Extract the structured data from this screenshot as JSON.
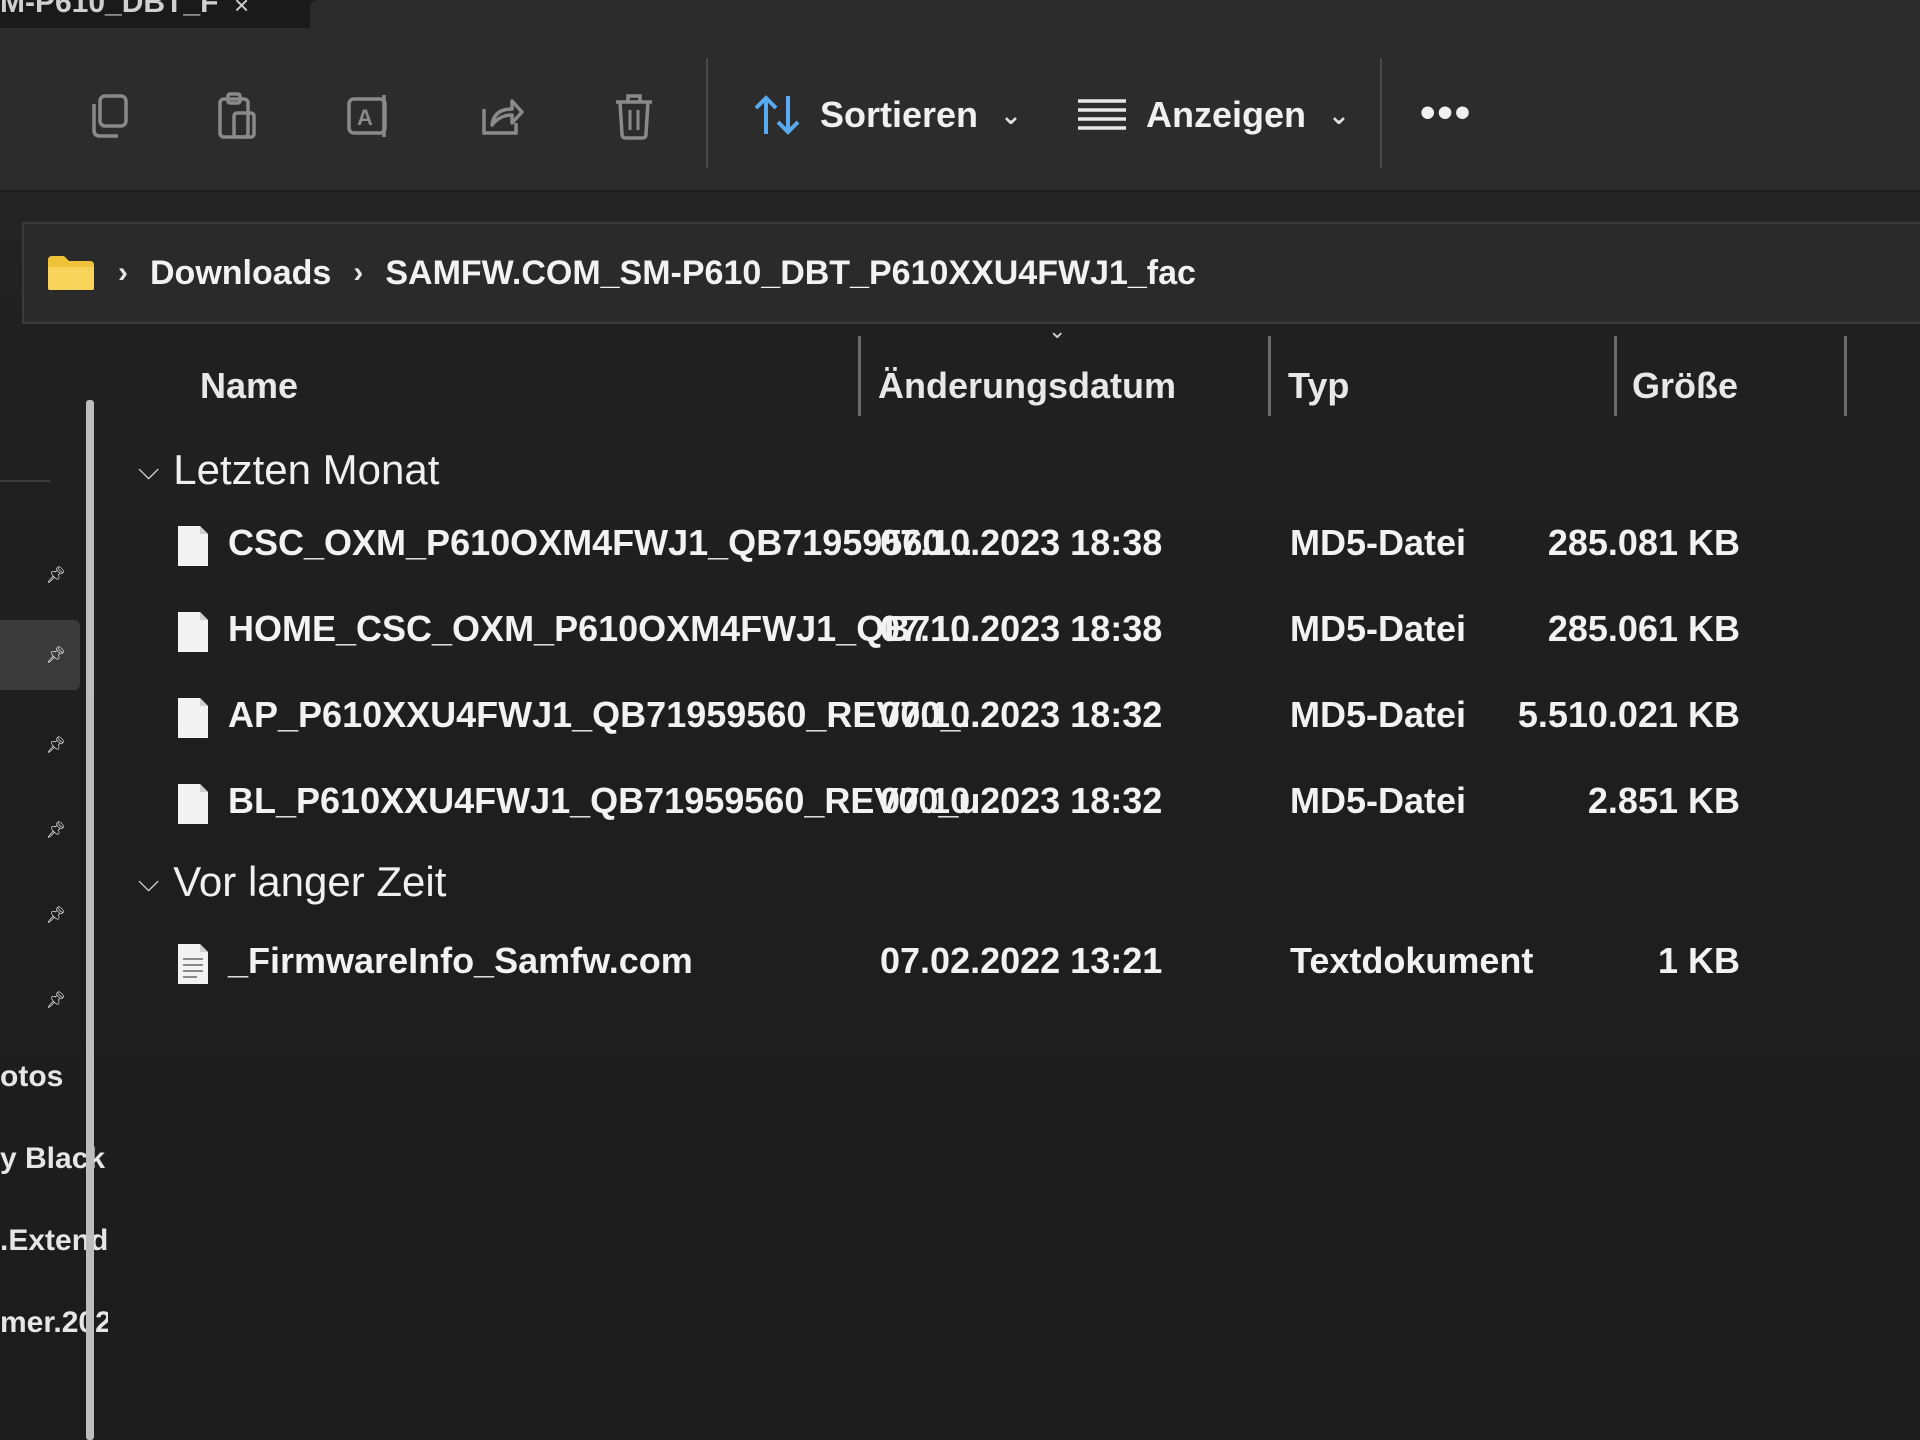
{
  "window": {
    "title_fragment": "M-P610_DBT_F",
    "title_close": "×"
  },
  "toolbar": {
    "icons": [
      {
        "name": "copy-icon"
      },
      {
        "name": "paste-icon"
      },
      {
        "name": "rename-icon"
      },
      {
        "name": "share-icon"
      },
      {
        "name": "delete-icon"
      }
    ],
    "sort_label": "Sortieren",
    "view_label": "Anzeigen",
    "more_label": "•••"
  },
  "address": {
    "separator": "›",
    "crumbs": [
      "Downloads",
      "SAMFW.COM_SM-P610_DBT_P610XXU4FWJ1_fac"
    ]
  },
  "nav": {
    "items": [
      "otos",
      "y Black",
      ".Extend",
      "mer.202"
    ]
  },
  "columns": {
    "name": "Name",
    "date": "Änderungsdatum",
    "type": "Typ",
    "size": "Größe"
  },
  "groups": [
    {
      "label": "Letzten Monat",
      "files": [
        {
          "name": "CSC_OXM_P610OXM4FWJ1_QB71959560...",
          "date": "07.10.2023 18:38",
          "type": "MD5-Datei",
          "size": "285.081 KB"
        },
        {
          "name": "HOME_CSC_OXM_P610OXM4FWJ1_QB71...",
          "date": "07.10.2023 18:38",
          "type": "MD5-Datei",
          "size": "285.061 KB"
        },
        {
          "name": "AP_P610XXU4FWJ1_QB71959560_REV00_...",
          "date": "07.10.2023 18:32",
          "type": "MD5-Datei",
          "size": "5.510.021 KB"
        },
        {
          "name": "BL_P610XXU4FWJ1_QB71959560_REV00_u...",
          "date": "07.10.2023 18:32",
          "type": "MD5-Datei",
          "size": "2.851 KB"
        }
      ]
    },
    {
      "label": "Vor langer Zeit",
      "files": [
        {
          "name": "_FirmwareInfo_Samfw.com",
          "date": "07.02.2022 13:21",
          "type": "Textdokument",
          "size": "1 KB"
        }
      ]
    }
  ],
  "colors": {
    "background": "#1d1d1d",
    "toolbar": "#2c2c2c",
    "folder": "#f0c23a",
    "text": "#f2f2f2"
  }
}
